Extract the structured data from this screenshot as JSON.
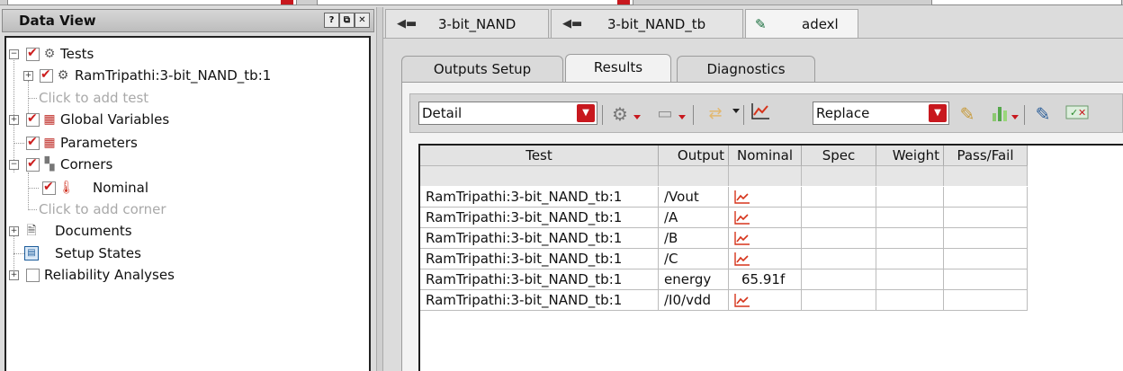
{
  "colors": {
    "accent_red": "#c8181e",
    "check_red": "#cc1d1d",
    "plot_red": "#d6341b"
  },
  "data_view": {
    "title": "Data View",
    "buttons": [
      "?",
      "⧉",
      "✕"
    ],
    "tree": [
      {
        "label": "Tests",
        "icon": "gears-icon",
        "checked": true
      },
      {
        "label": "RamTripathi:3-bit_NAND_tb:1",
        "icon": "gear-icon",
        "checked": true
      },
      {
        "label": "Click to add test",
        "placeholder": true
      },
      {
        "label": "Global Variables",
        "icon": "cubes-icon",
        "checked": true
      },
      {
        "label": "Parameters",
        "icon": "cubes-icon",
        "checked": true
      },
      {
        "label": "Corners",
        "icon": "corners-icon",
        "checked": true
      },
      {
        "label": "Nominal",
        "icon": "thermometer-icon",
        "checked": true
      },
      {
        "label": "Click to add corner",
        "placeholder": true
      },
      {
        "label": "Documents",
        "icon": "document-icon"
      },
      {
        "label": "Setup States",
        "icon": "setup-states-icon"
      },
      {
        "label": "Reliability Analyses",
        "checked": false
      }
    ]
  },
  "doc_tabs": [
    {
      "label": "3-bit_NAND",
      "icon": "schematic-icon"
    },
    {
      "label": "3-bit_NAND_tb",
      "icon": "schematic-icon"
    },
    {
      "label": "adexl",
      "icon": "pen-icon"
    }
  ],
  "inner_tabs": [
    "Outputs Setup",
    "Results",
    "Diagnostics"
  ],
  "toolbar": {
    "view_select": "Detail",
    "plot_mode_select": "Replace"
  },
  "results_table": {
    "headers": [
      "Test",
      "Output",
      "Nominal",
      "Spec",
      "Weight",
      "Pass/Fail"
    ],
    "rows": [
      {
        "test": "RamTripathi:3-bit_NAND_tb:1",
        "output": "/Vout",
        "nominal": null
      },
      {
        "test": "RamTripathi:3-bit_NAND_tb:1",
        "output": "/A",
        "nominal": null
      },
      {
        "test": "RamTripathi:3-bit_NAND_tb:1",
        "output": "/B",
        "nominal": null
      },
      {
        "test": "RamTripathi:3-bit_NAND_tb:1",
        "output": "/C",
        "nominal": null
      },
      {
        "test": "RamTripathi:3-bit_NAND_tb:1",
        "output": "energy",
        "nominal": "65.91f"
      },
      {
        "test": "RamTripathi:3-bit_NAND_tb:1",
        "output": "/I0/vdd",
        "nominal": null
      }
    ]
  }
}
